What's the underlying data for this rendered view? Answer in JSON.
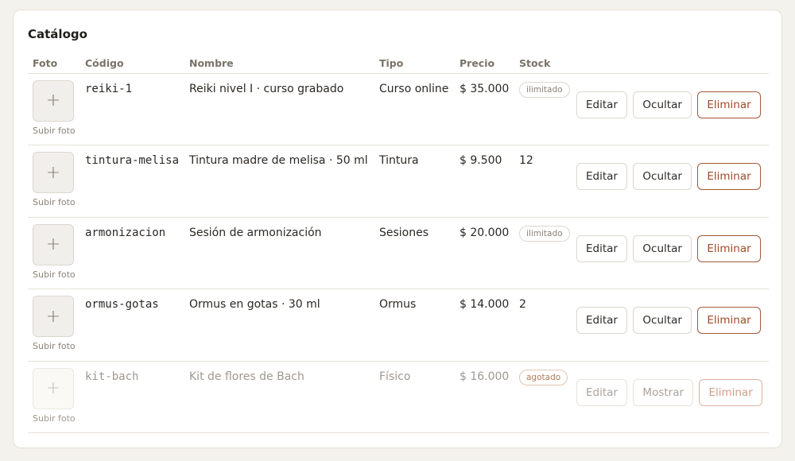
{
  "card": {
    "title": "Catálogo"
  },
  "table": {
    "headers": {
      "foto": "Foto",
      "codigo": "Código",
      "nombre": "Nombre",
      "tipo": "Tipo",
      "precio": "Precio",
      "stock": "Stock"
    },
    "upload_label": "Subir foto",
    "upload_plus": "+",
    "rows": [
      {
        "codigo": "reiki-1",
        "nombre": "Reiki nivel I · curso grabado",
        "tipo": "Curso online",
        "precio": "$ 35.000",
        "stock": "ilimitado",
        "stock_badge": true,
        "edit": "Editar",
        "toggle": "Ocultar",
        "delete": "Eliminar",
        "muted": false
      },
      {
        "codigo": "tintura-melisa",
        "nombre": "Tintura madre de melisa · 50 ml",
        "tipo": "Tintura",
        "precio": "$ 9.500",
        "stock": "12",
        "stock_badge": false,
        "edit": "Editar",
        "toggle": "Ocultar",
        "delete": "Eliminar",
        "muted": false
      },
      {
        "codigo": "armonizacion",
        "nombre": "Sesión de armonización",
        "tipo": "Sesiones",
        "precio": "$ 20.000",
        "stock": "ilimitado",
        "stock_badge": true,
        "edit": "Editar",
        "toggle": "Ocultar",
        "delete": "Eliminar",
        "muted": false
      },
      {
        "codigo": "ormus-gotas",
        "nombre": "Ormus en gotas · 30 ml",
        "tipo": "Ormus",
        "precio": "$ 14.000",
        "stock": "2",
        "stock_badge": false,
        "edit": "Editar",
        "toggle": "Ocultar",
        "delete": "Eliminar",
        "muted": false
      },
      {
        "codigo": "kit-bach",
        "nombre": "Kit de flores de Bach",
        "tipo": "Físico",
        "precio": "$ 16.000",
        "stock": "agotado",
        "stock_badge": true,
        "edit": "Editar",
        "toggle": "Mostrar",
        "delete": "Eliminar",
        "muted": true
      }
    ]
  },
  "colors": {
    "background": "#f4f2ed",
    "card": "#ffffff",
    "danger": "#9b4a2a",
    "badge_agotado": "#b27a55"
  },
  "icons": {
    "upload": "plus-icon"
  }
}
